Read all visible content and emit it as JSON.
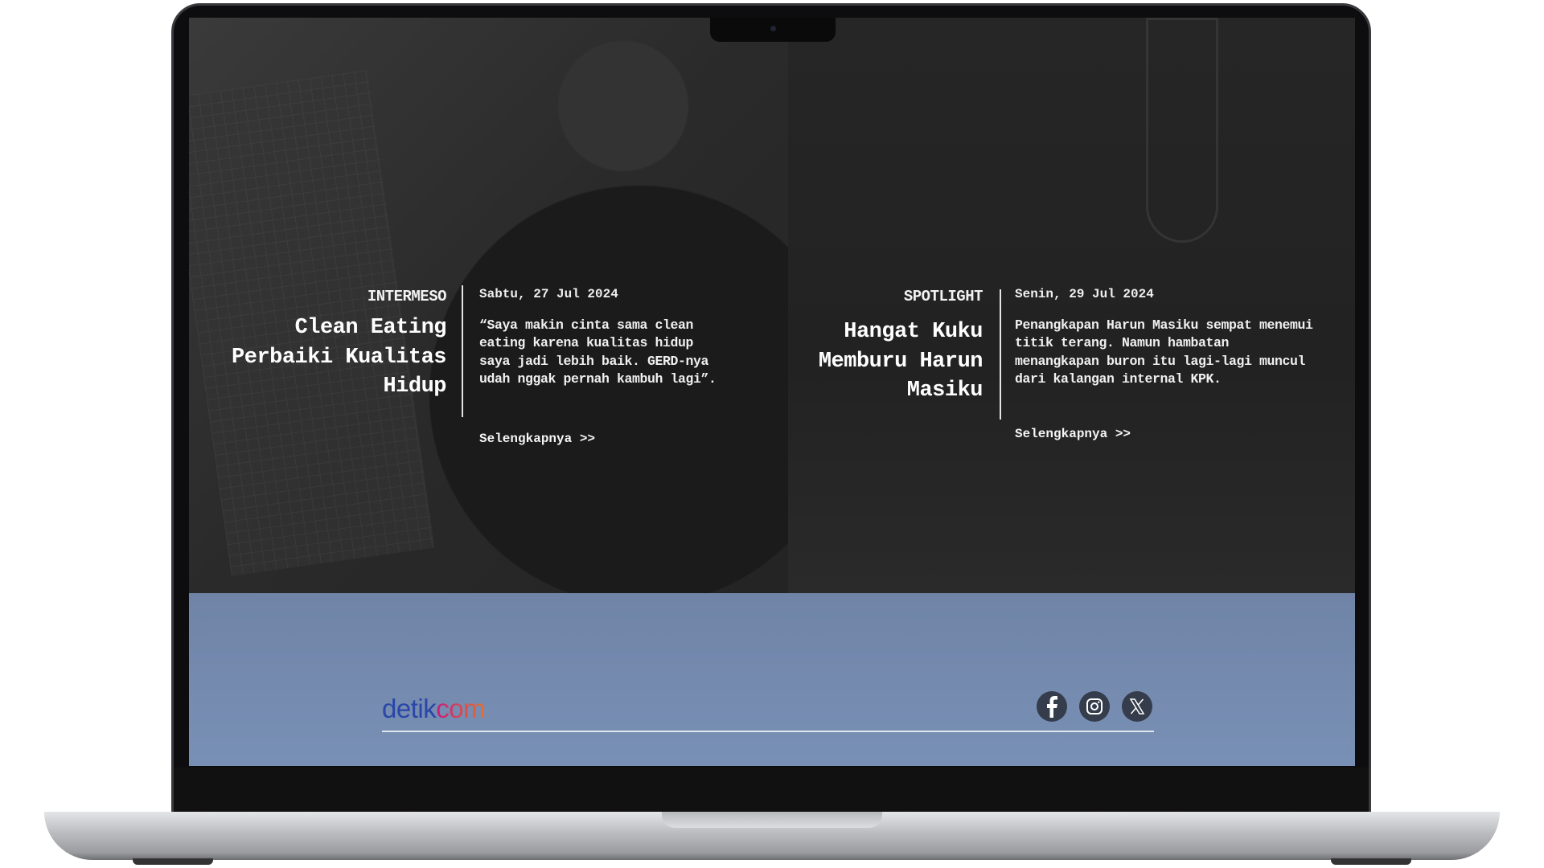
{
  "articles": [
    {
      "category": "INTERMESO",
      "title_lines": [
        "Clean Eating",
        "Perbaiki Kualitas",
        "Hidup"
      ],
      "date": "Sabtu, 27 Jul 2024",
      "excerpt": "“Saya makin cinta sama clean\neating karena kualitas hidup\nsaya jadi lebih baik. GERD-nya\nudah nggak pernah kambuh lagi”.",
      "more_link": "Selengkapnya >>"
    },
    {
      "category": "SPOTLIGHT",
      "title_lines": [
        "Hangat Kuku",
        "Memburu Harun",
        "Masiku"
      ],
      "date": "Senin, 29 Jul 2024",
      "excerpt": "Penangkapan Harun Masiku sempat menemui\ntitik terang. Namun hambatan\nmenangkapan buron itu lagi-lagi muncul\ndari kalangan internal KPK.",
      "more_link": "Selengkapnya >>"
    }
  ],
  "footer": {
    "logo_part1": "detik",
    "logo_part2": "com",
    "social": [
      "facebook-icon",
      "instagram-icon",
      "x-icon"
    ],
    "colors": {
      "background": "#7489ad",
      "logo_blue": "#2946a8",
      "logo_gradient_start": "#c61e7d",
      "logo_gradient_end": "#e6702c"
    }
  }
}
